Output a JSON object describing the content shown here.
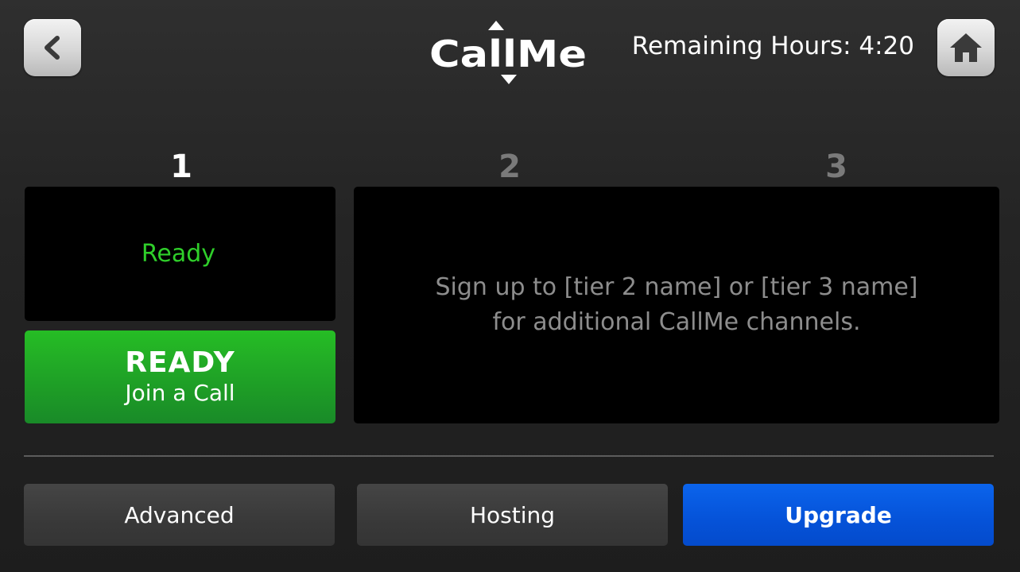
{
  "header": {
    "logo_text": "CallMe",
    "remaining_hours_label": "Remaining Hours: 4:20",
    "back_icon": "chevron-left-icon",
    "home_icon": "home-icon"
  },
  "channels": [
    {
      "number": "1",
      "active": true
    },
    {
      "number": "2",
      "active": false
    },
    {
      "number": "3",
      "active": false
    }
  ],
  "channel1": {
    "status": "Ready",
    "button_title": "READY",
    "button_subtitle": "Join a Call"
  },
  "upsell": {
    "line1": "Sign up to [tier 2 name] or [tier 3 name]",
    "line2": "for additional CallMe channels."
  },
  "footer": {
    "advanced_label": "Advanced",
    "hosting_label": "Hosting",
    "upgrade_label": "Upgrade"
  },
  "colors": {
    "status_green": "#2fcf2a",
    "ready_button_green": "#1e9e26",
    "upgrade_blue": "#0552d8",
    "inactive_number": "#7a7a7a"
  }
}
